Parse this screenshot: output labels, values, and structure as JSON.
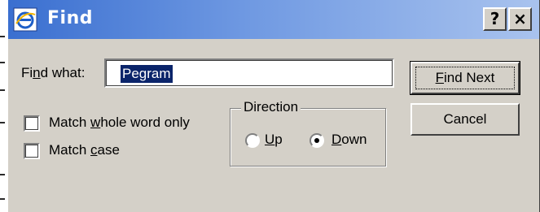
{
  "window": {
    "title": "Find"
  },
  "titlebar_buttons": {
    "help": "?",
    "close": "×"
  },
  "find": {
    "label_pre": "Fi",
    "label_mnemonic": "n",
    "label_post": "d what:",
    "value": "Pegram"
  },
  "options": {
    "whole_word": {
      "pre": "Match ",
      "mnemonic": "w",
      "post": "hole word only",
      "checked": false
    },
    "match_case": {
      "pre": "Match ",
      "mnemonic": "c",
      "post": "ase",
      "checked": false
    }
  },
  "direction": {
    "legend": "Direction",
    "up": {
      "mnemonic": "U",
      "post": "p",
      "selected": false
    },
    "down": {
      "mnemonic": "D",
      "post": "own",
      "selected": true
    }
  },
  "buttons": {
    "find_next": {
      "mnemonic": "F",
      "post": "ind Next"
    },
    "cancel": "Cancel"
  },
  "colors": {
    "titlebar_start": "#3a6fd0",
    "titlebar_end": "#a9c3ee",
    "dialog_face": "#d4d0c8",
    "selection": "#0a246a"
  },
  "icons": {
    "title": "internet-explorer-icon"
  }
}
